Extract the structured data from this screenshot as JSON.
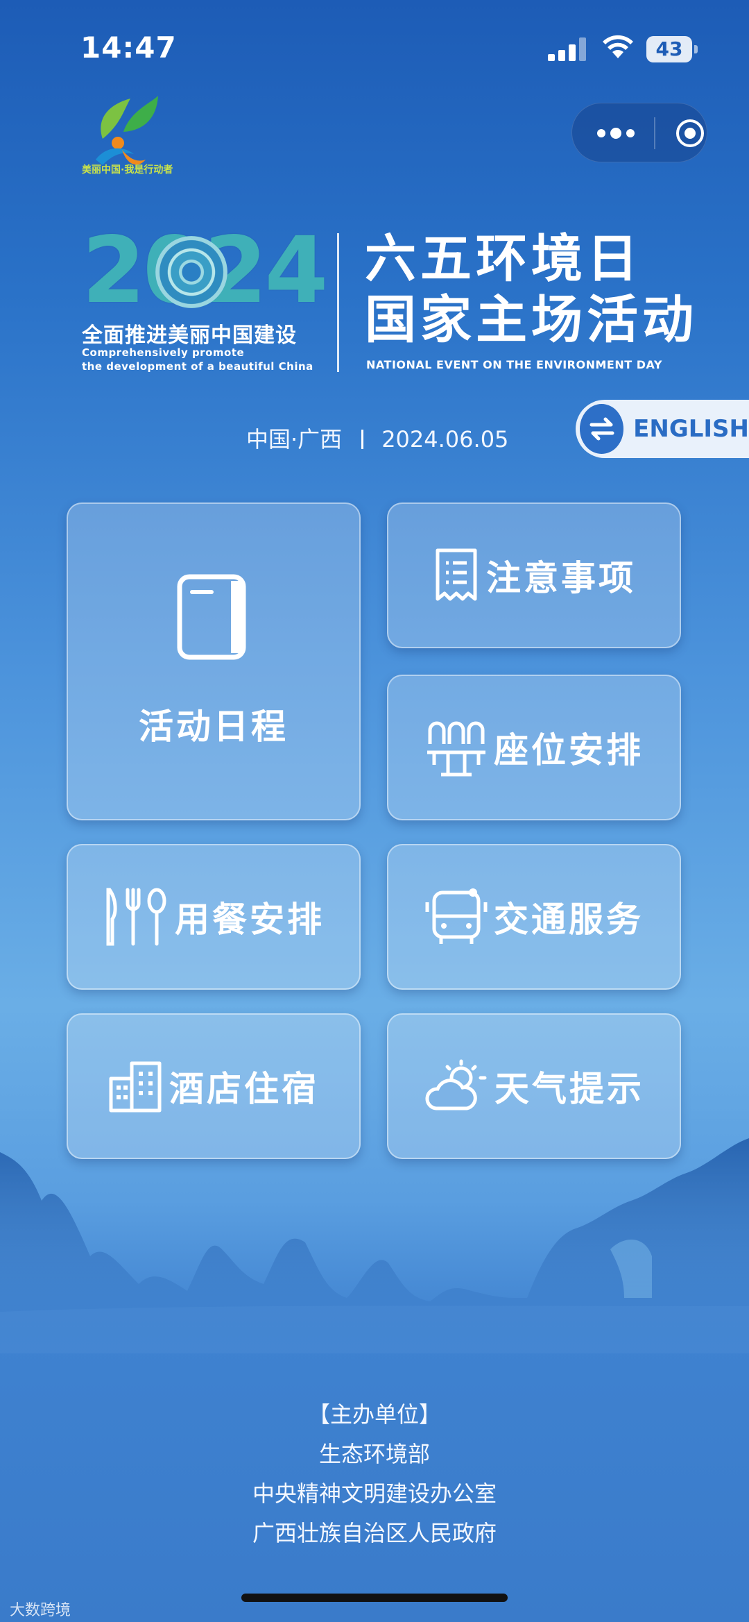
{
  "status_bar": {
    "time": "14:47",
    "battery": "43"
  },
  "logo": {
    "caption": "美丽中国·我是行动者"
  },
  "banner": {
    "year": "2024",
    "slogan_cn": "全面推进美丽中国建设",
    "slogan_en_line1": "Comprehensively promote",
    "slogan_en_line2": "the development of a beautiful China",
    "title_line1": "六五环境日",
    "title_line2": "国家主场活动",
    "title_en": "NATIONAL EVENT ON THE ENVIRONMENT DAY"
  },
  "meta": {
    "location": "中国·广西",
    "date": "2024.06.05"
  },
  "language_button": {
    "label": "ENGLISH"
  },
  "menu": {
    "schedule": "活动日程",
    "notice": "注意事项",
    "seating": "座位安排",
    "dining": "用餐安排",
    "transport": "交通服务",
    "hotel": "酒店住宿",
    "weather": "天气提示"
  },
  "sponsors": {
    "heading": "【主办单位】",
    "org1": "生态环境部",
    "org2": "中央精神文明建设办公室",
    "org3": "广西壮族自治区人民政府"
  },
  "watermark": "大数跨境"
}
